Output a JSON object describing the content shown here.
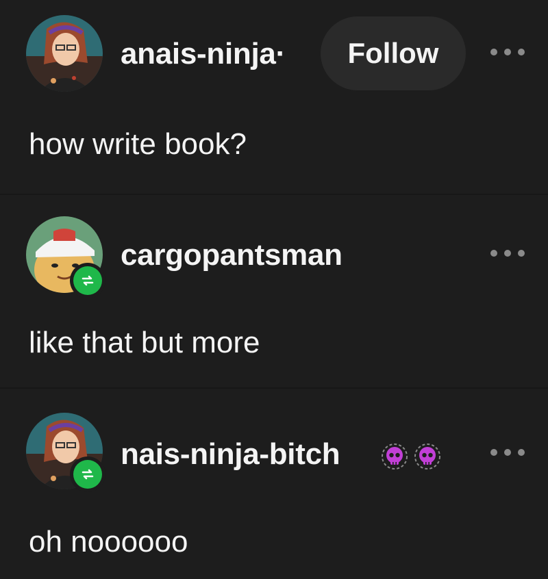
{
  "posts": [
    {
      "username": "anais-ninja·",
      "follow_label": "Follow",
      "text": "how write book?"
    },
    {
      "username": "cargopantsman",
      "text": "like that but more"
    },
    {
      "username": "nais-ninja-bitch",
      "text": "oh noooooo"
    }
  ],
  "icons": {
    "more": "more-options-icon",
    "reblog": "reblog-icon",
    "badge": "skull-badge-icon"
  },
  "colors": {
    "background": "#1d1d1d",
    "follow_button": "#2a2a2a",
    "reblog_green": "#1fb84a",
    "badge_purple": "#c13fd6"
  }
}
